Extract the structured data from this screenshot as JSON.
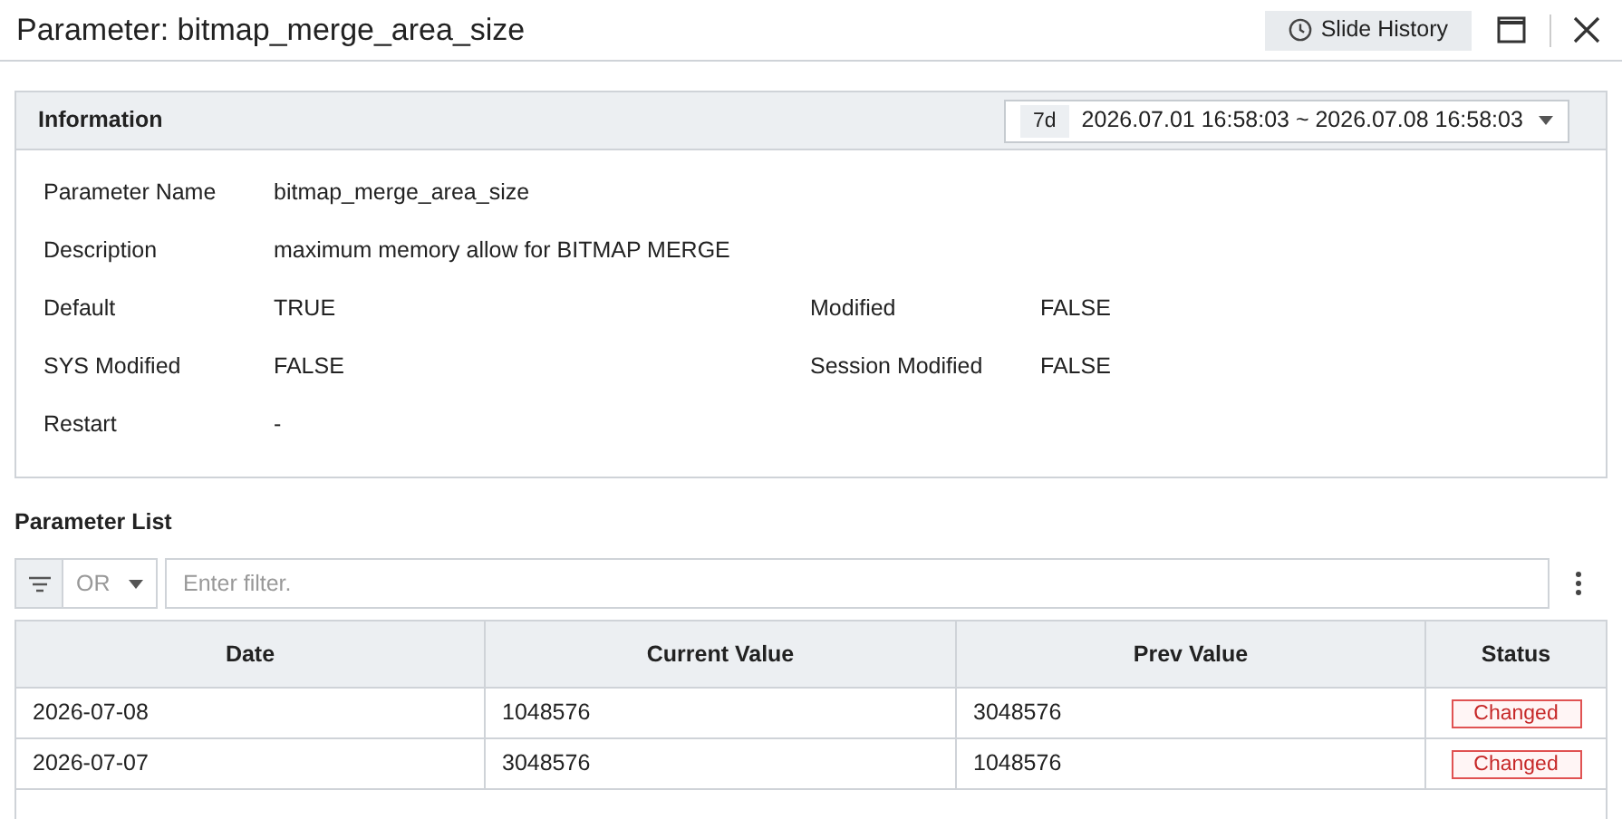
{
  "window": {
    "title": "Parameter: bitmap_merge_area_size",
    "slide_history_button": "Slide History"
  },
  "information": {
    "title": "Information",
    "range_badge": "7d",
    "range": "2026.07.01 16:58:03 ~ 2026.07.08 16:58:03",
    "rows": [
      [
        {
          "label": "Parameter Name",
          "value": "bitmap_merge_area_size"
        }
      ],
      [
        {
          "label": "Description",
          "value": "maximum memory allow for BITMAP MERGE"
        }
      ],
      [
        {
          "label": "Default",
          "value": "TRUE"
        },
        {
          "label": "Modified",
          "value": "FALSE"
        }
      ],
      [
        {
          "label": "SYS Modified",
          "value": "FALSE"
        },
        {
          "label": "Session Modified",
          "value": "FALSE"
        }
      ],
      [
        {
          "label": "Restart",
          "value": "-"
        }
      ]
    ]
  },
  "parameter_list": {
    "title": "Parameter List",
    "operator": "OR",
    "filter_placeholder": "Enter filter.",
    "columns": [
      "Date",
      "Current Value",
      "Prev Value",
      "Status"
    ],
    "rows": [
      {
        "date": "2026-07-08",
        "current": "1048576",
        "prev": "3048576",
        "status": {
          "text": "Changed",
          "kind": "changed"
        }
      },
      {
        "date": "2026-07-07",
        "current": "3048576",
        "prev": "1048576",
        "status": {
          "text": "Changed",
          "kind": "changed"
        }
      }
    ]
  }
}
